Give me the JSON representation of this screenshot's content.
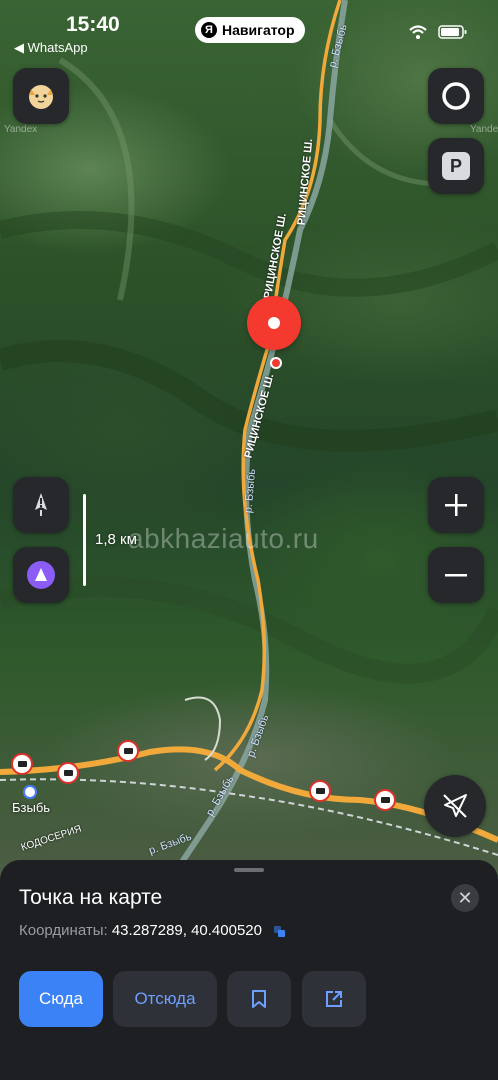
{
  "status_bar": {
    "time": "15:40",
    "back_app": "◀ WhatsApp"
  },
  "navigator_pill": {
    "logo": "Я",
    "label": "Навигатор"
  },
  "map": {
    "scale_label": "1,8 км",
    "watermark": "abkhaziauto.ru",
    "map_logo": "Yandex",
    "town_label": "Бзыбь",
    "road_labels": [
      "РИЦИНСКОЕ Ш.",
      "РИЦИНСКОЕ Ш.",
      "РИЦИНСКОЕ Ш.",
      "КОДОСЕРИЯ"
    ],
    "river_labels": [
      "р. Бзыбь",
      "р. Бзыбь",
      "р. Бзыбь",
      "р. Бзыбь",
      "р. Бзыбь"
    ]
  },
  "icons": {
    "profile": "cat-avatar-icon",
    "compass": "alice-circle-icon",
    "parking": "parking-icon",
    "warning": "road-event-icon",
    "alice": "alice-icon",
    "zoom_in": "plus-icon",
    "zoom_out": "minus-icon",
    "location": "location-arrow-icon"
  },
  "parking_label": "P",
  "sheet": {
    "title": "Точка на карте",
    "coords_label": "Координаты:",
    "coords_value": "43.287289, 40.400520",
    "close_label": "✕",
    "btn_here": "Сюда",
    "btn_from": "Отсюда"
  },
  "colors": {
    "accent": "#3b82f6",
    "pin": "#f43a2f",
    "road": "#f2a93b",
    "sheet": "#1d1f23"
  }
}
